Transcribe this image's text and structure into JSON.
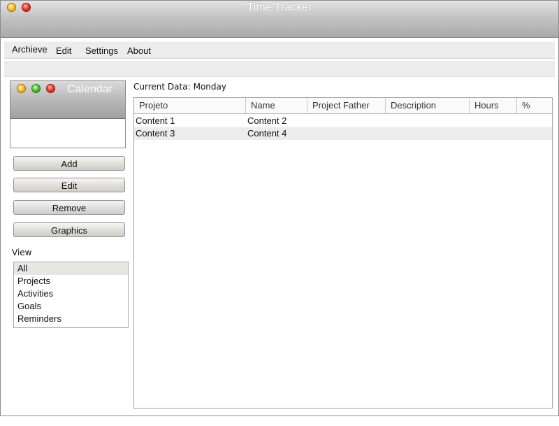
{
  "window": {
    "title": "Time Tracker"
  },
  "menu": {
    "items": [
      "Archieve",
      "Edit",
      "Settings",
      "About"
    ]
  },
  "calendar": {
    "title": "Calendar"
  },
  "buttons": {
    "add": "Add",
    "edit": "Edit",
    "remove": "Remove",
    "graphics": "Graphics"
  },
  "view": {
    "label": "View",
    "items": [
      "All",
      "Projects",
      "Activities",
      "Goals",
      "Reminders"
    ],
    "selected": "All"
  },
  "current": {
    "label": "Current Data:",
    "value": "Monday"
  },
  "table": {
    "columns": [
      "Projeto",
      "Name",
      "Project Father",
      "Description",
      "Hours",
      "%"
    ],
    "rows": [
      [
        "Content 1",
        "Content 2",
        "",
        "",
        "",
        ""
      ],
      [
        "Content 3",
        "Content 4",
        "",
        "",
        "",
        ""
      ]
    ]
  },
  "colors": {
    "titlebar": "#b9b9b9",
    "menubar": "#ececec",
    "row_alt": "#ececec",
    "selected": "#e8e6e2"
  }
}
